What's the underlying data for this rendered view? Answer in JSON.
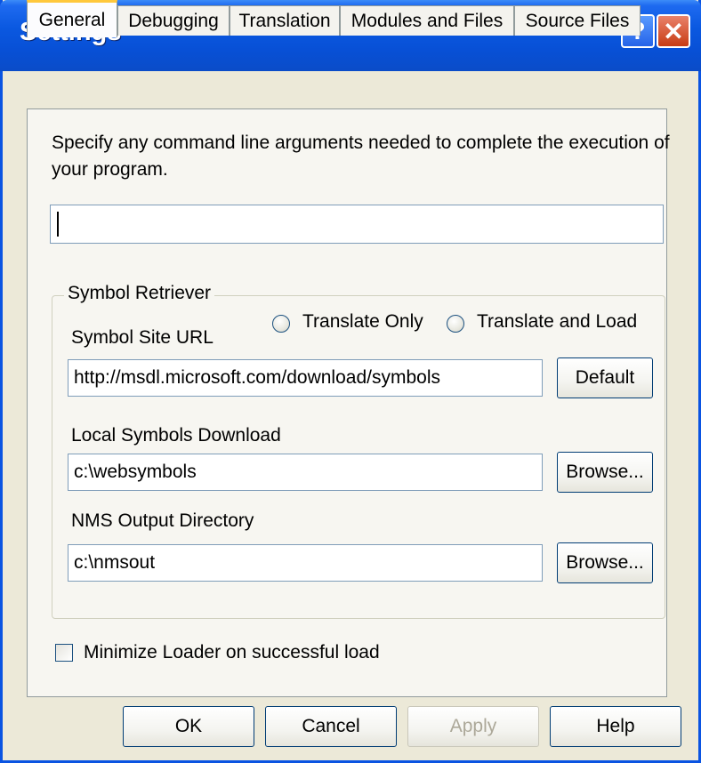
{
  "window": {
    "title": "Settings",
    "help_glyph": "?",
    "close_glyph": "✕"
  },
  "tabs": [
    {
      "label": "General"
    },
    {
      "label": "Debugging"
    },
    {
      "label": "Translation"
    },
    {
      "label": "Modules and Files"
    },
    {
      "label": "Source Files"
    }
  ],
  "general": {
    "description": "Specify any command line arguments needed to complete the execution of your program.",
    "arguments_value": ""
  },
  "symbol_retriever": {
    "group_label": "Symbol Retriever",
    "radio_translate_only": "Translate Only",
    "radio_translate_and_load": "Translate and Load",
    "symbol_site_url_label": "Symbol Site URL",
    "symbol_site_url_value": "http://msdl.microsoft.com/download/symbols",
    "default_button": "Default",
    "local_symbols_label": "Local Symbols Download",
    "local_symbols_value": "c:\\websymbols",
    "browse_button": "Browse...",
    "nms_output_label": "NMS Output Directory",
    "nms_output_value": "c:\\nmsout",
    "browse_button_2": "Browse..."
  },
  "minimize_checkbox_label": "Minimize Loader on successful load",
  "minimize_checked": false,
  "buttons": {
    "ok": "OK",
    "cancel": "Cancel",
    "apply": "Apply",
    "help": "Help"
  },
  "colors": {
    "title_bar": "#0A58E0",
    "dialog_bg": "#ECE9D8",
    "tab_highlight": "#FFC83C"
  }
}
